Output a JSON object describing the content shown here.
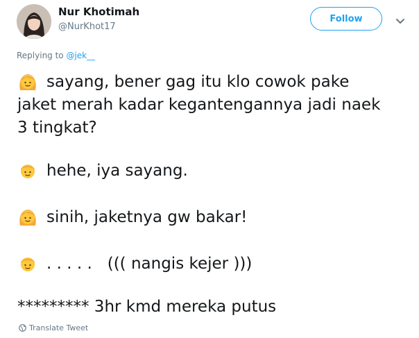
{
  "user": {
    "name": "Nur Khotimah",
    "handle": "@NurKhot17"
  },
  "follow_button": {
    "label": "Follow"
  },
  "reply": {
    "prefix": "Replying to ",
    "mention": "@jek__"
  },
  "tweet": {
    "lines": [
      {
        "emoji": "woman-emoji-icon",
        "text": "sayang, bener gag itu klo cowok pake"
      },
      {
        "emoji": "",
        "text": "jaket merah kadar kegantengannya jadi naek"
      },
      {
        "emoji": "",
        "text": "3 tingkat?"
      },
      {
        "emoji": "man-emoji-icon",
        "text": "hehe, iya sayang."
      },
      {
        "emoji": "woman-emoji-icon",
        "text": "sinih, jaketnya gw bakar!"
      },
      {
        "emoji": "man-emoji-icon",
        "text": ". . . . .   ((( nangis kejer )))"
      },
      {
        "emoji": "",
        "text": "********* 3hr kmd mereka putus"
      }
    ]
  },
  "translate": {
    "label": "Translate Tweet",
    "icon": "globe-icon"
  },
  "colors": {
    "accent": "#1da1f2",
    "text": "#14171a",
    "muted": "#657786",
    "emoji_skin": "#ffc83d",
    "emoji_hair": "#f2a93b"
  }
}
